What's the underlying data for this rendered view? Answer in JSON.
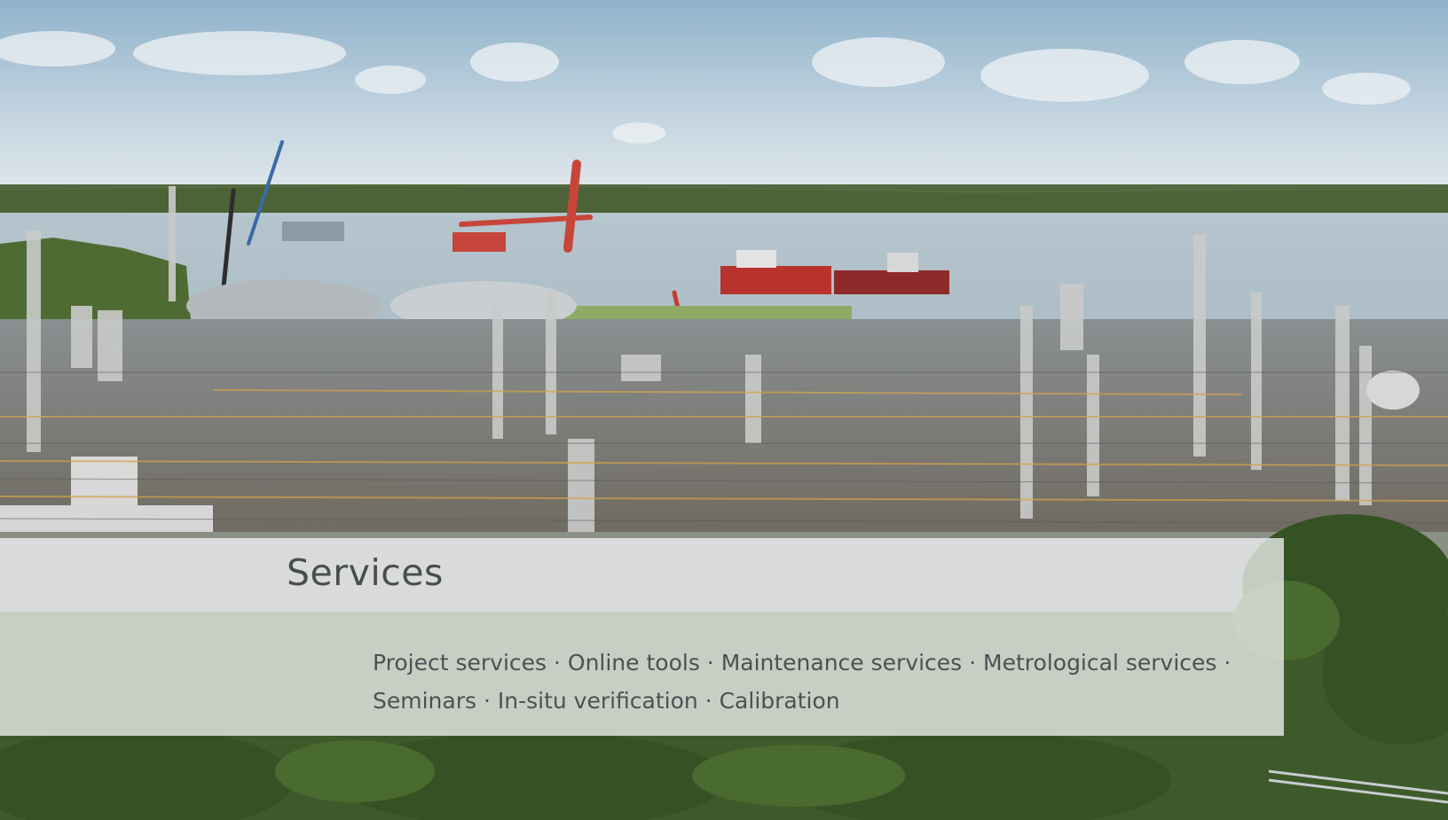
{
  "panel": {
    "title": "Services",
    "items_line_1": "Project services · Online tools · Maintenance services · Metrological services ·",
    "items_line_2": "Seminars · In-situ verification · Calibration"
  }
}
